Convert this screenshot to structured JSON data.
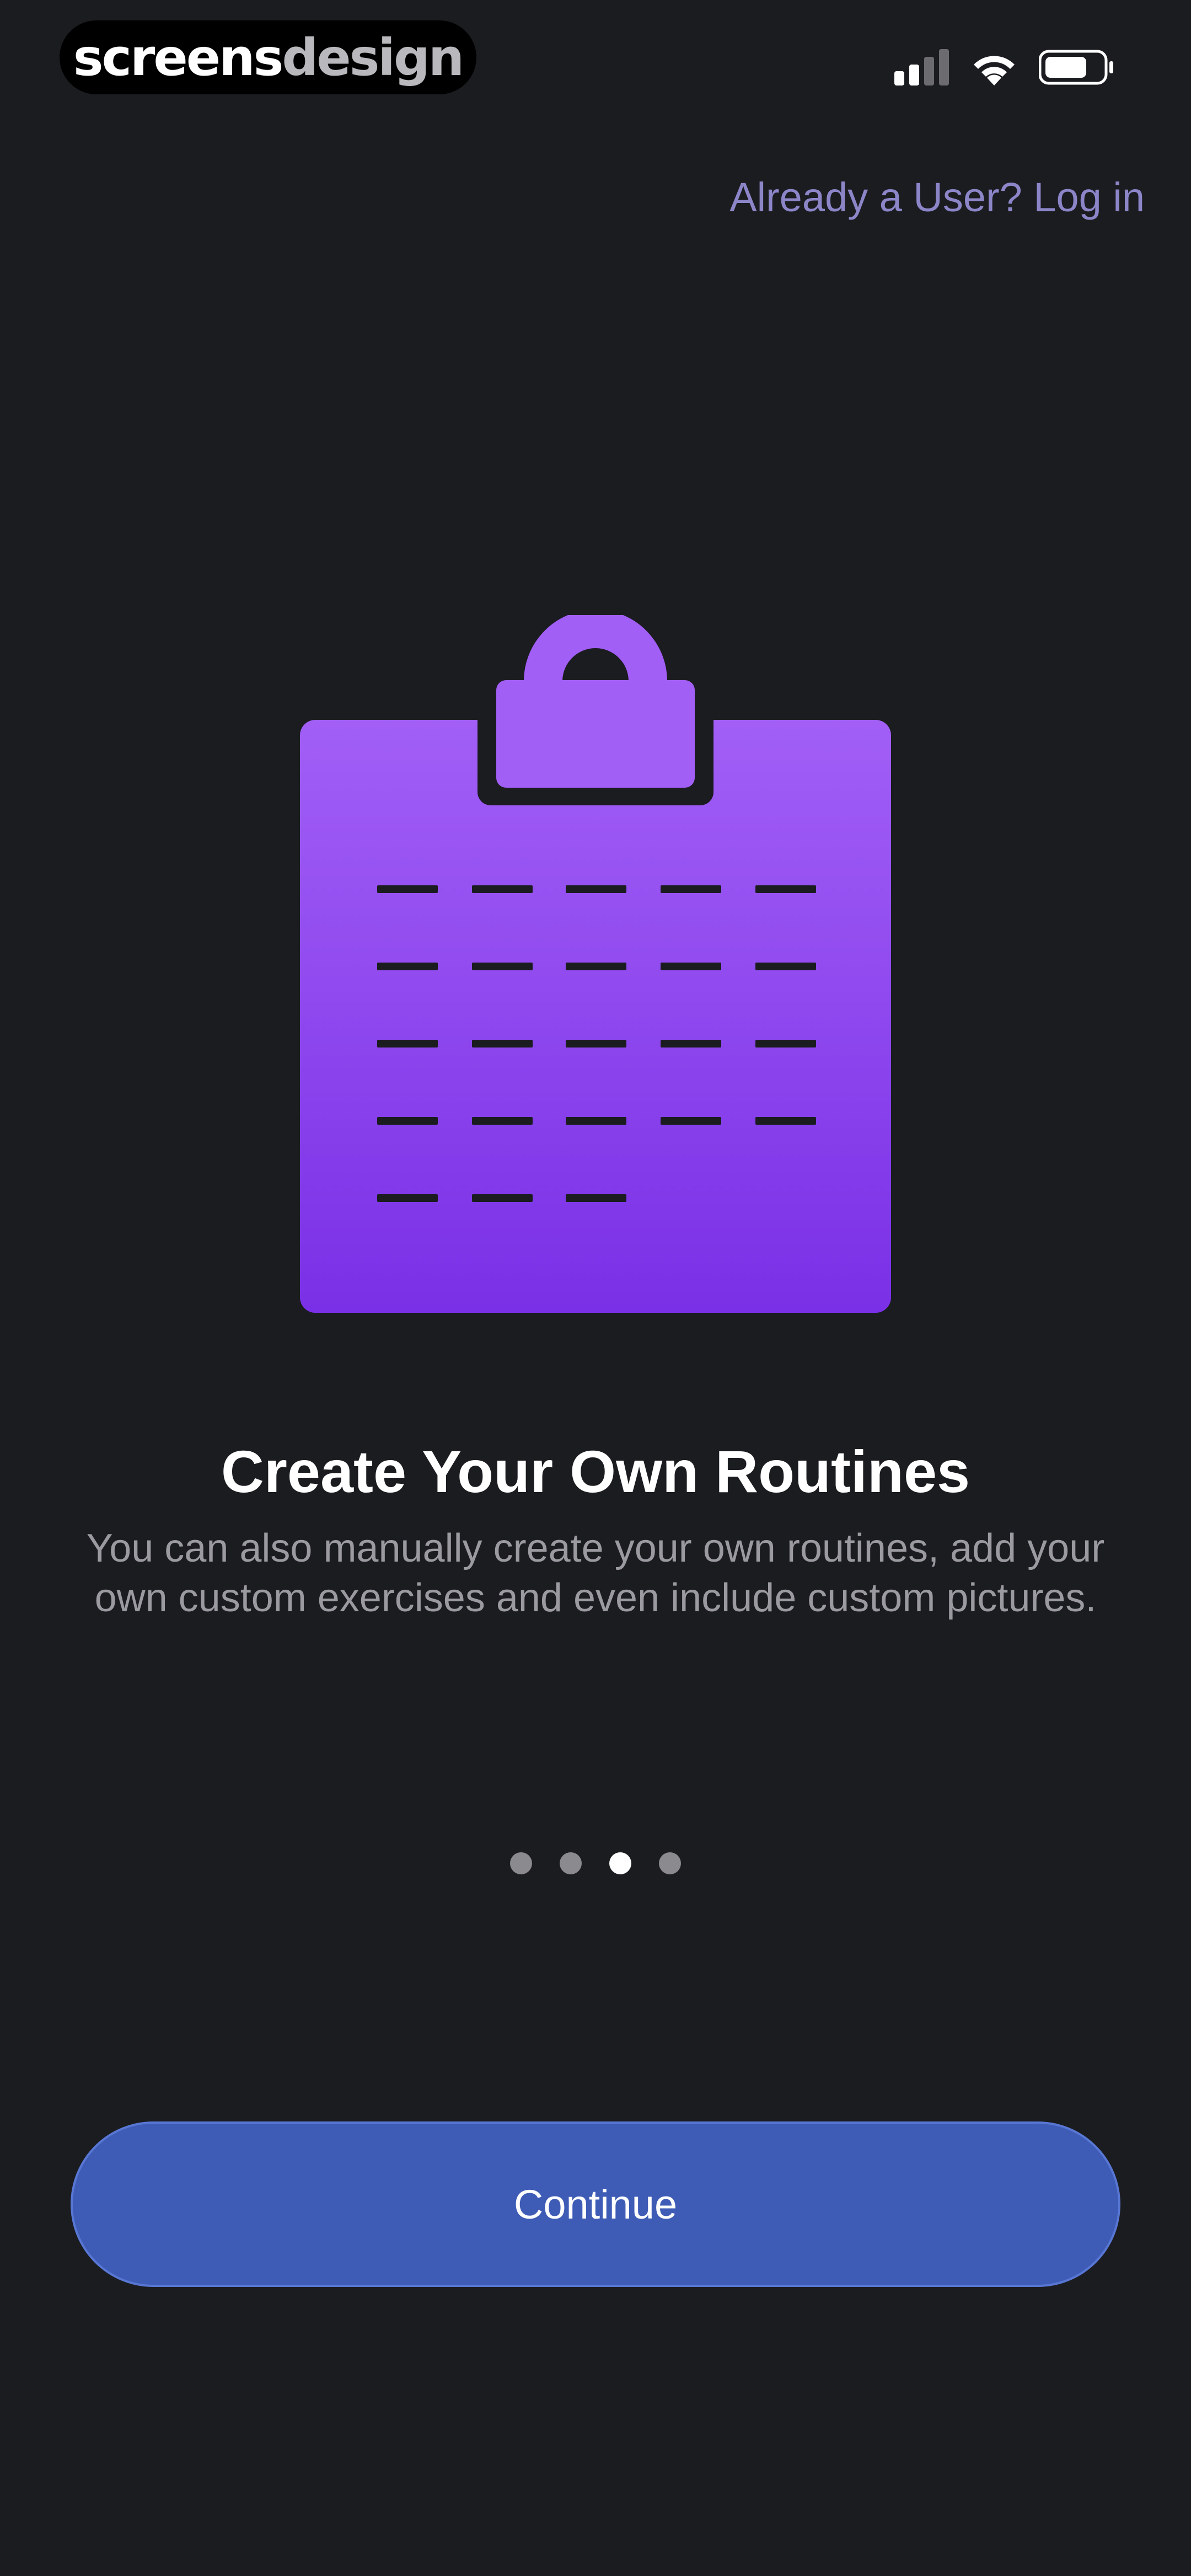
{
  "status_bar": {
    "watermark_part1": "screens",
    "watermark_part2": "design",
    "icons": [
      "cellular-signal-icon",
      "wifi-icon",
      "battery-icon"
    ]
  },
  "header": {
    "login_link": "Already a User? Log in"
  },
  "onboarding": {
    "illustration_icon": "clipboard-icon",
    "title": "Create Your Own Routines",
    "description": "You can also manually create your own routines, add your own custom exercises and even include custom pictures.",
    "page_count": 4,
    "current_page": 3
  },
  "footer": {
    "continue_label": "Continue"
  },
  "colors": {
    "background": "#1b1c20",
    "accent_purple": "#9a5cf5",
    "button_blue": "#3e5cb6",
    "link_purple": "#8c86c9"
  }
}
